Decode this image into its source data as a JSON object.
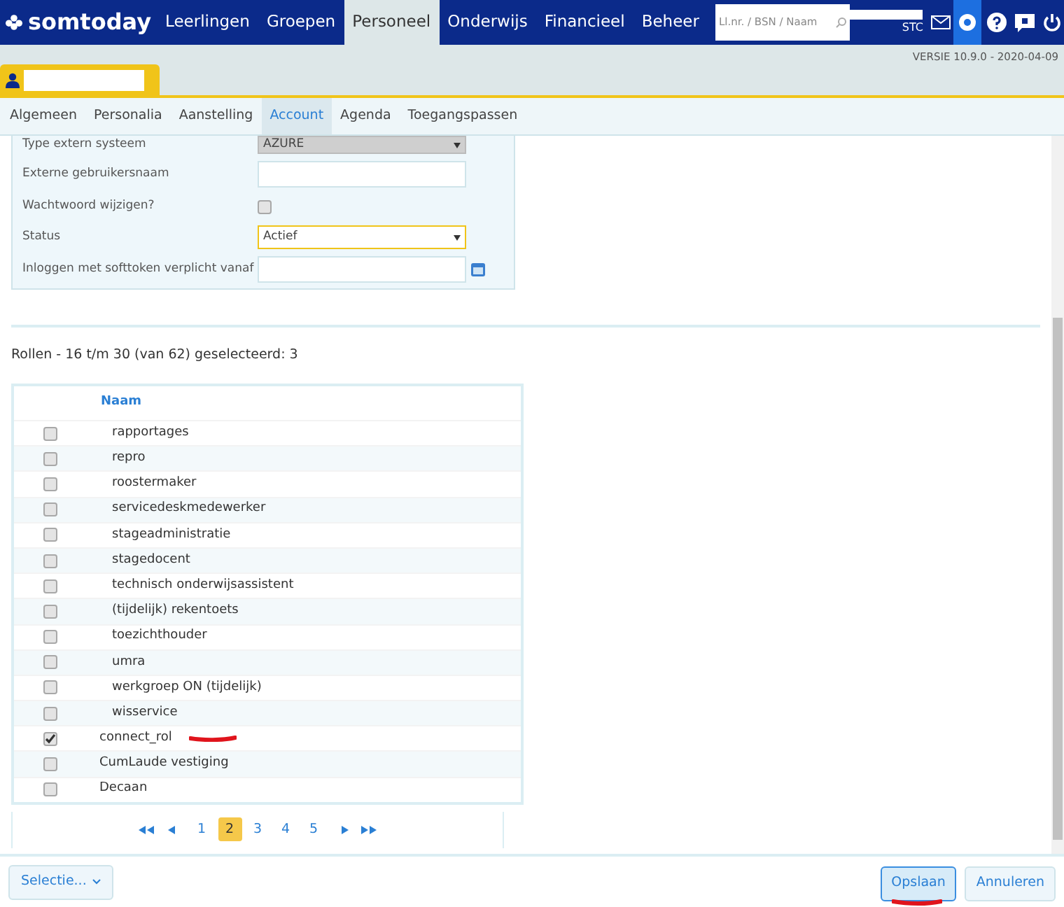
{
  "nav": {
    "logo": "somtoday",
    "items": [
      {
        "label": "Leerlingen",
        "selected": false
      },
      {
        "label": "Groepen",
        "selected": false
      },
      {
        "label": "Personeel",
        "selected": true
      },
      {
        "label": "Onderwijs",
        "selected": false
      },
      {
        "label": "Financieel",
        "selected": false
      },
      {
        "label": "Beheer",
        "selected": false
      }
    ],
    "search": {
      "placeholder": "Ll.nr. / BSN / Naam"
    },
    "user_code": "STC"
  },
  "version": "VERSIE 10.9.0 - 2020-04-09",
  "tabs": [
    {
      "label": "Algemeen",
      "selected": false
    },
    {
      "label": "Personalia",
      "selected": false
    },
    {
      "label": "Aanstelling",
      "selected": false
    },
    {
      "label": "Account",
      "selected": true
    },
    {
      "label": "Agenda",
      "selected": false
    },
    {
      "label": "Toegangspassen",
      "selected": false
    }
  ],
  "form": [
    {
      "kind": "select",
      "label": "Type extern systeem",
      "value": "AZURE",
      "disabled": true
    },
    {
      "kind": "text",
      "label": "Externe gebruikersnaam"
    },
    {
      "kind": "checkbox",
      "label": "Wachtwoord wijzigen?",
      "checked": false
    },
    {
      "kind": "select",
      "label": "Status",
      "value": "Actief",
      "disabled": false
    },
    {
      "kind": "date",
      "label": "Inloggen met softtoken verplicht vanaf"
    }
  ],
  "roles": {
    "title": "Rollen - 16 t/m 30 (van 62) geselecteerd: 3",
    "column": "Naam",
    "rows": [
      {
        "name": "rapportages",
        "checked": false,
        "indented": true
      },
      {
        "name": "repro",
        "checked": false,
        "indented": true
      },
      {
        "name": "roostermaker",
        "checked": false,
        "indented": true
      },
      {
        "name": "servicedeskmedewerker",
        "checked": false,
        "indented": true
      },
      {
        "name": "stageadministratie",
        "checked": false,
        "indented": true
      },
      {
        "name": "stagedocent",
        "checked": false,
        "indented": true
      },
      {
        "name": "technisch onderwijsassistent",
        "checked": false,
        "indented": true
      },
      {
        "name": "(tijdelijk) rekentoets",
        "checked": false,
        "indented": true
      },
      {
        "name": "toezichthouder",
        "checked": false,
        "indented": true
      },
      {
        "name": "umra",
        "checked": false,
        "indented": true
      },
      {
        "name": "werkgroep ON (tijdelijk)",
        "checked": false,
        "indented": true
      },
      {
        "name": "wisservice",
        "checked": false,
        "indented": true
      },
      {
        "name": "connect_rol",
        "checked": true,
        "indented": false
      },
      {
        "name": "CumLaude vestiging",
        "checked": false,
        "indented": false
      },
      {
        "name": "Decaan",
        "checked": false,
        "indented": false
      }
    ],
    "pages": [
      {
        "label": "1",
        "selected": false
      },
      {
        "label": "2",
        "selected": true
      },
      {
        "label": "3",
        "selected": false
      },
      {
        "label": "4",
        "selected": false
      },
      {
        "label": "5",
        "selected": false
      }
    ]
  },
  "footer": {
    "selection": "Selectie...",
    "buttons": [
      {
        "label": "Opslaan",
        "selected": true
      },
      {
        "label": "Annuleren",
        "selected": false
      }
    ]
  }
}
